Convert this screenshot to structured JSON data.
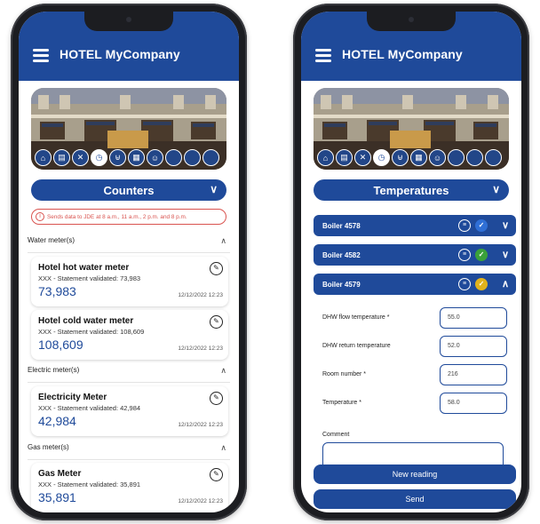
{
  "app": {
    "title": "HOTEL MyCompany"
  },
  "colors": {
    "primary": "#1f4a9a",
    "alert": "#d9534f",
    "status_ok": "#3aa13a",
    "status_pending": "#e0b21c",
    "status_info": "#2f6fd6"
  },
  "tab_icons": [
    "home-icon",
    "document-icon",
    "tools-icon",
    "counter-icon",
    "cart-icon",
    "grid-icon",
    "person-icon",
    "empty",
    "empty",
    "empty"
  ],
  "counters_screen": {
    "selector": "Counters",
    "info": "Sends data to JDE at 8 a.m., 11 a.m., 2 p.m. and 8 p.m.",
    "sections": [
      {
        "title": "Water meter(s)",
        "meters": [
          {
            "name": "Hotel hot water meter",
            "status": "XXX - Statement validated: 73,983",
            "value": "73,983",
            "date": "12/12/2022 12:23"
          },
          {
            "name": "Hotel cold water meter",
            "status": "XXX - Statement validated: 108,609",
            "value": "108,609",
            "date": "12/12/2022 12:23"
          }
        ]
      },
      {
        "title": "Electric meter(s)",
        "meters": [
          {
            "name": "Electricity Meter",
            "status": "XXX - Statement validated: 42,984",
            "value": "42,984",
            "date": "12/12/2022 12:23"
          }
        ]
      },
      {
        "title": "Gas meter(s)",
        "meters": [
          {
            "name": "Gas Meter",
            "status": "XXX - Statement validated: 35,891",
            "value": "35,891",
            "date": "12/12/2022 12:23"
          }
        ]
      }
    ]
  },
  "temperatures_screen": {
    "selector": "Temperatures",
    "boilers": [
      {
        "name": "Boiler 4578",
        "status": "info",
        "expanded": false
      },
      {
        "name": "Boiler 4582",
        "status": "ok",
        "expanded": false
      },
      {
        "name": "Boiler 4579",
        "status": "pending",
        "expanded": true
      }
    ],
    "fields": [
      {
        "label": "DHW flow temperature *",
        "value": "55.0"
      },
      {
        "label": "DHW return temperature",
        "value": "52.0"
      },
      {
        "label": "Room number *",
        "value": "216"
      },
      {
        "label": "Temperature *",
        "value": "58.0"
      }
    ],
    "comment_label": "Comment",
    "comment_value": "",
    "new_reading": "New reading",
    "send": "Send"
  }
}
